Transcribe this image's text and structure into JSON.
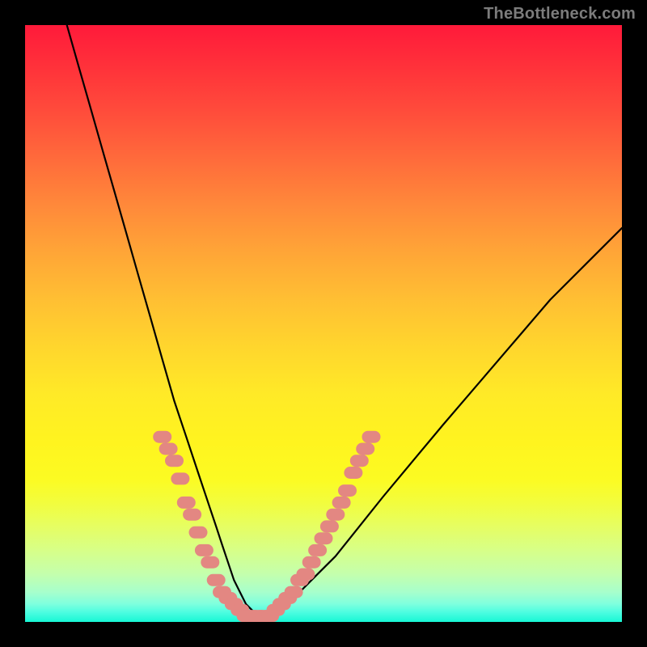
{
  "watermark": "TheBottleneck.com",
  "colors": {
    "curve": "#000000",
    "marker_fill": "#e38782",
    "marker_stroke": "#e38782",
    "frame": "#000000"
  },
  "chart_data": {
    "type": "line",
    "title": "",
    "xlabel": "",
    "ylabel": "",
    "xlim": [
      0,
      100
    ],
    "ylim": [
      0,
      100
    ],
    "grid": false,
    "legend": false,
    "series": [
      {
        "name": "bottleneck-curve",
        "x": [
          7,
          9,
          11,
          13,
          15,
          17,
          19,
          21,
          23,
          25,
          27,
          29,
          31,
          32,
          33,
          34,
          35,
          36,
          37,
          38,
          39,
          40,
          42,
          45,
          48,
          52,
          56,
          60,
          65,
          70,
          76,
          82,
          88,
          95,
          100
        ],
        "y": [
          100,
          93,
          86,
          79,
          72,
          65,
          58,
          51,
          44,
          37,
          31,
          25,
          19,
          16,
          13,
          10,
          7,
          5,
          3,
          2,
          1,
          1,
          2,
          4,
          7,
          11,
          16,
          21,
          27,
          33,
          40,
          47,
          54,
          61,
          66
        ]
      }
    ],
    "markers": {
      "name": "highlighted-points",
      "points": [
        {
          "x": 23,
          "y": 31
        },
        {
          "x": 24,
          "y": 29
        },
        {
          "x": 25,
          "y": 27
        },
        {
          "x": 26,
          "y": 24
        },
        {
          "x": 27,
          "y": 20
        },
        {
          "x": 28,
          "y": 18
        },
        {
          "x": 29,
          "y": 15
        },
        {
          "x": 30,
          "y": 12
        },
        {
          "x": 31,
          "y": 10
        },
        {
          "x": 32,
          "y": 7
        },
        {
          "x": 33,
          "y": 5
        },
        {
          "x": 34,
          "y": 4
        },
        {
          "x": 35,
          "y": 3
        },
        {
          "x": 36,
          "y": 2
        },
        {
          "x": 37,
          "y": 1
        },
        {
          "x": 38,
          "y": 1
        },
        {
          "x": 39,
          "y": 1
        },
        {
          "x": 40,
          "y": 1
        },
        {
          "x": 41,
          "y": 1
        },
        {
          "x": 42,
          "y": 2
        },
        {
          "x": 43,
          "y": 3
        },
        {
          "x": 44,
          "y": 4
        },
        {
          "x": 45,
          "y": 5
        },
        {
          "x": 46,
          "y": 7
        },
        {
          "x": 47,
          "y": 8
        },
        {
          "x": 48,
          "y": 10
        },
        {
          "x": 49,
          "y": 12
        },
        {
          "x": 50,
          "y": 14
        },
        {
          "x": 51,
          "y": 16
        },
        {
          "x": 52,
          "y": 18
        },
        {
          "x": 53,
          "y": 20
        },
        {
          "x": 54,
          "y": 22
        },
        {
          "x": 55,
          "y": 25
        },
        {
          "x": 56,
          "y": 27
        },
        {
          "x": 57,
          "y": 29
        },
        {
          "x": 58,
          "y": 31
        }
      ]
    }
  }
}
